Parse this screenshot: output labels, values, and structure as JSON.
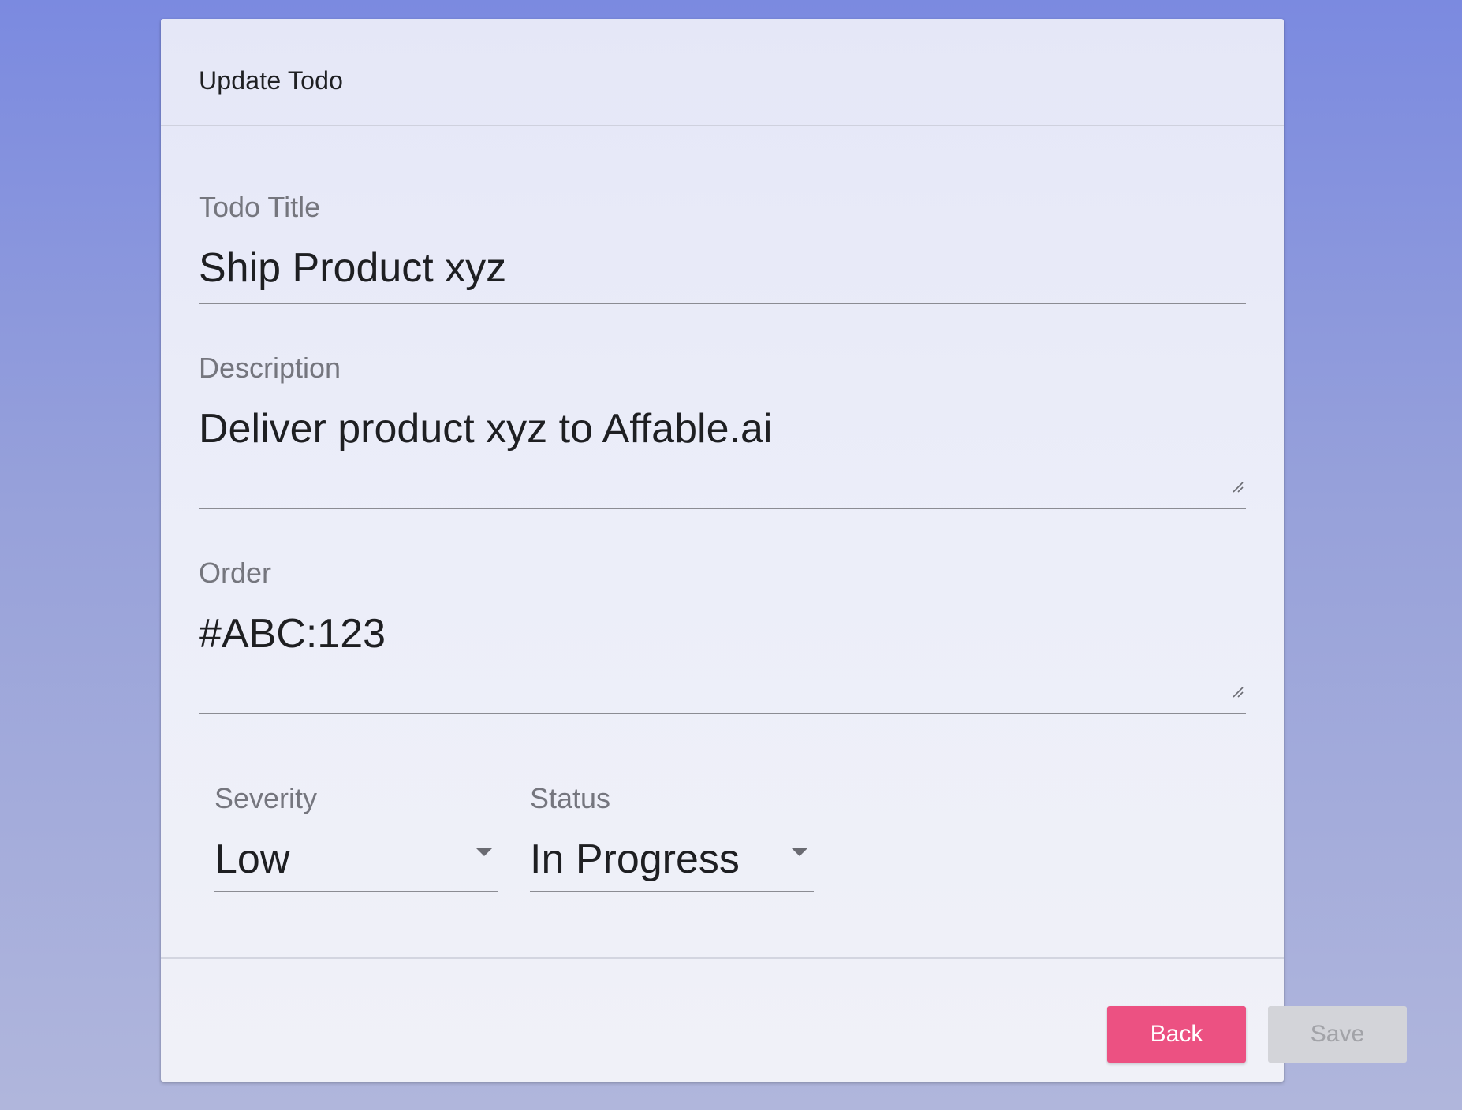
{
  "card": {
    "title": "Update Todo"
  },
  "form": {
    "todo_title": {
      "label": "Todo Title",
      "value": "Ship Product xyz"
    },
    "description": {
      "label": "Description",
      "value": "Deliver product xyz to Affable.ai"
    },
    "order": {
      "label": "Order",
      "value": "#ABC:123"
    },
    "severity": {
      "label": "Severity",
      "value": "Low"
    },
    "status": {
      "label": "Status",
      "value": "In Progress"
    }
  },
  "actions": {
    "back_label": "Back",
    "save_label": "Save",
    "save_disabled": true
  },
  "colors": {
    "accent": "#ec5182",
    "disabled_button": "#d3d4d9",
    "background_top": "#7b8ae0",
    "background_bottom": "#b0b6dc"
  },
  "icons": {
    "resize_handle": "resize-handle-icon",
    "dropdown": "dropdown-arrow-icon"
  }
}
